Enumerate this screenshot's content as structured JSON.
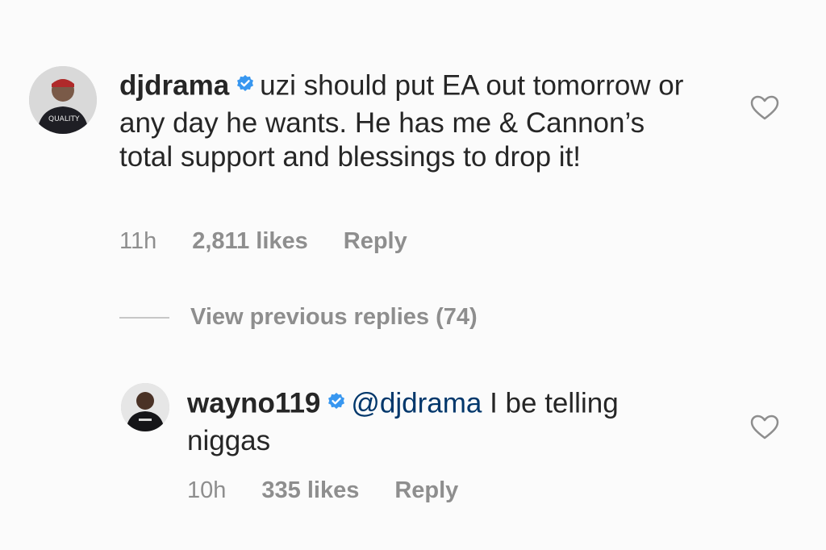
{
  "comments": [
    {
      "username": "djdrama",
      "text": "uzi should put EA out tomorrow or any day he wants. He has me & Cannon’s total support and blessings to drop it!",
      "time": "11h",
      "likes": "2,811 likes",
      "reply_label": "Reply",
      "avatar_icon": "user-avatar"
    },
    {
      "username": "wayno119",
      "mention": "@djdrama",
      "text": "I be telling niggas",
      "time": "10h",
      "likes": "335 likes",
      "reply_label": "Reply",
      "avatar_icon": "user-avatar"
    }
  ],
  "view_previous_replies": "View previous replies (74)",
  "colors": {
    "verified": "#3897f0",
    "mention": "#00376b",
    "meta": "#8e8e8e"
  }
}
